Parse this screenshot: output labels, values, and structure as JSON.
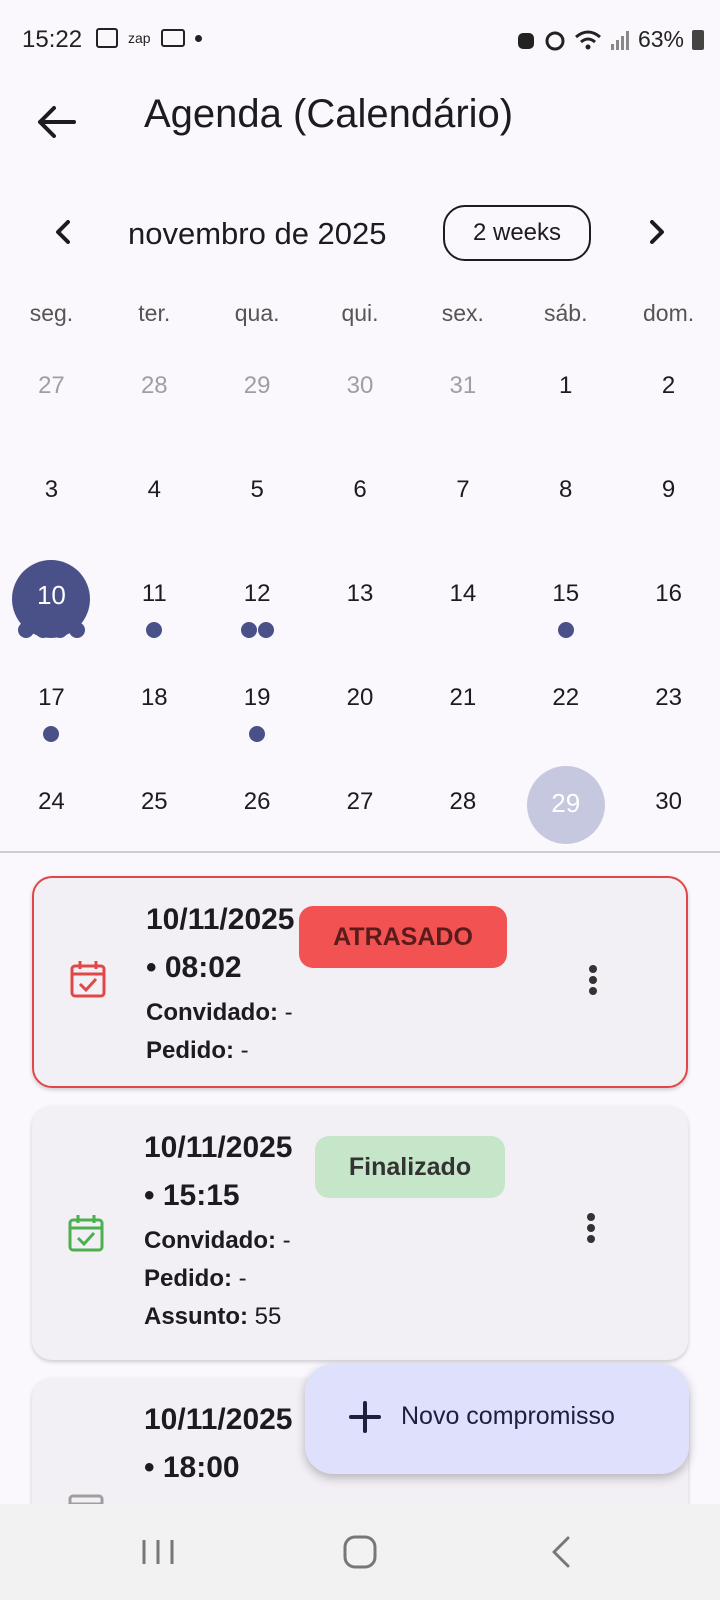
{
  "status_bar": {
    "time": "15:22",
    "left_icons": [
      "image-icon",
      "zap-icon",
      "voicemail-icon",
      "dot-icon"
    ],
    "zap_text": "zap",
    "right_icons": [
      "recycle-icon",
      "alarm-icon",
      "wifi-icon",
      "signal-icon"
    ],
    "battery": "63%"
  },
  "app_bar": {
    "title": "Agenda (Calendário)",
    "back_icon": "arrow-left-icon"
  },
  "calendar": {
    "month_label": "novembro de 2025",
    "format_button": "2 weeks",
    "weekdays": [
      "seg.",
      "ter.",
      "qua.",
      "qui.",
      "sex.",
      "sáb.",
      "dom."
    ],
    "weeks": [
      [
        "27",
        "28",
        "29",
        "30",
        "31",
        "1",
        "2"
      ],
      [
        "3",
        "4",
        "5",
        "6",
        "7",
        "8",
        "9"
      ],
      [
        "10",
        "11",
        "12",
        "13",
        "14",
        "15",
        "16"
      ],
      [
        "17",
        "18",
        "19",
        "20",
        "21",
        "22",
        "23"
      ],
      [
        "24",
        "25",
        "26",
        "27",
        "28",
        "29",
        "30"
      ]
    ],
    "selected_day": "10",
    "today": "29",
    "event_markers": {
      "10": 4,
      "11": 1,
      "12": 2,
      "15": 1,
      "17": 1,
      "19": 1
    },
    "accent_color": "#4a5188"
  },
  "events": [
    {
      "datetime": "10/11/2025 • 08:02",
      "status": "ATRASADO",
      "status_color": "#f25252",
      "icon_color": "#e04848",
      "guest_label": "Convidado:",
      "guest_value": "-",
      "order_label": "Pedido:",
      "order_value": "-"
    },
    {
      "datetime": "10/11/2025 • 15:15",
      "status": "Finalizado",
      "status_color": "#c6e6c9",
      "icon_color": "#4caf50",
      "guest_label": "Convidado:",
      "guest_value": "-",
      "order_label": "Pedido:",
      "order_value": "-",
      "subject_label": "Assunto:",
      "subject_value": "55"
    },
    {
      "datetime": "10/11/2025 • 18:00",
      "icon_color": "#9e9e9e"
    }
  ],
  "fab": {
    "label": "Novo compromisso",
    "icon": "plus-icon"
  },
  "nav_bar": {
    "icons": [
      "recent-apps-icon",
      "home-icon",
      "back-icon"
    ]
  }
}
